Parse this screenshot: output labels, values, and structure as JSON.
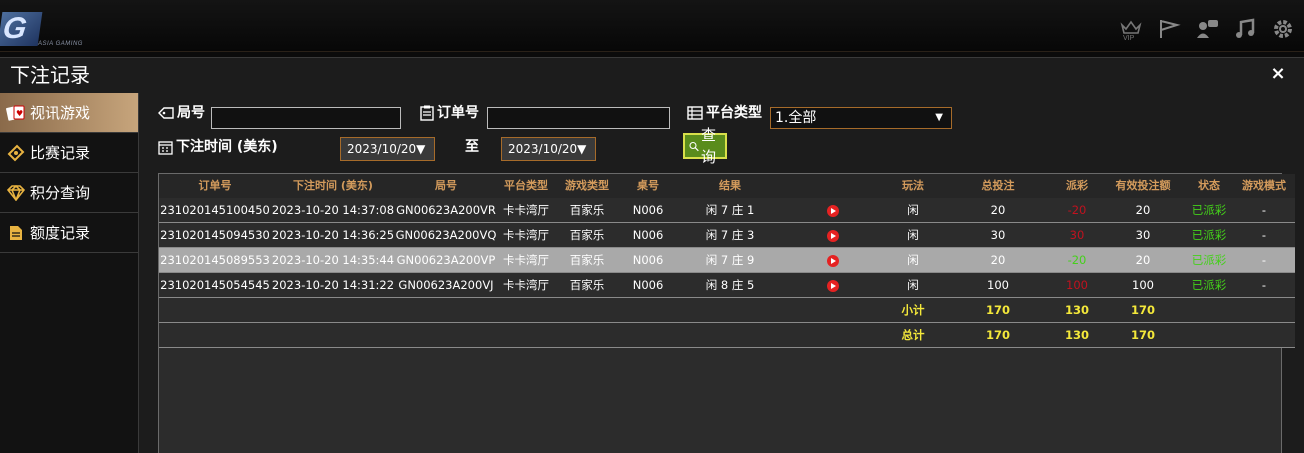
{
  "app": {
    "logo_letter": "G",
    "logo_text": "ASIA GAMING",
    "top_icons": [
      "vip-icon",
      "flag-icon",
      "chat-icon",
      "music-icon",
      "gear-icon"
    ]
  },
  "dialog": {
    "title": "下注记录",
    "close_label": "×"
  },
  "sidebar": {
    "items": [
      {
        "label": "视讯游戏",
        "icon": "cards-icon",
        "active": true
      },
      {
        "label": "比赛记录",
        "icon": "ticket-icon",
        "active": false
      },
      {
        "label": "积分查询",
        "icon": "diamond-icon",
        "active": false
      },
      {
        "label": "额度记录",
        "icon": "document-icon",
        "active": false
      }
    ]
  },
  "filters": {
    "round_label": "局号",
    "round_value": "",
    "order_label": "订单号",
    "order_value": "",
    "platform_label": "平台类型",
    "platform_value": "1.全部",
    "time_label": "下注时间 (美东)",
    "date_from": "2023/10/20▼",
    "to_label": "至",
    "date_to": "2023/10/20▼",
    "query_label": "查询"
  },
  "table": {
    "headers": [
      "订单号",
      "下注时间 (美东)",
      "局号",
      "平台类型",
      "游戏类型",
      "桌号",
      "结果",
      "",
      "玩法",
      "总投注",
      "派彩",
      "有效投注额",
      "状态",
      "游戏模式"
    ],
    "rows": [
      {
        "order": "231020145100450",
        "time": "2023-10-20 14:37:08",
        "round": "GN00623A200VR",
        "platform": "卡卡湾厅",
        "game": "百家乐",
        "table": "N006",
        "result": "闲 7 庄 1",
        "bet": "闲",
        "total": "20",
        "payout": "-20",
        "payout_color": "red",
        "valid": "20",
        "status": "已派彩",
        "mode": "-"
      },
      {
        "order": "231020145094530",
        "time": "2023-10-20 14:36:25",
        "round": "GN00623A200VQ",
        "platform": "卡卡湾厅",
        "game": "百家乐",
        "table": "N006",
        "result": "闲 7 庄 3",
        "bet": "闲",
        "total": "30",
        "payout": "30",
        "payout_color": "red",
        "valid": "30",
        "status": "已派彩",
        "mode": "-"
      },
      {
        "order": "231020145089553",
        "time": "2023-10-20 14:35:44",
        "round": "GN00623A200VP",
        "platform": "卡卡湾厅",
        "game": "百家乐",
        "table": "N006",
        "result": "闲 7 庄 9",
        "bet": "闲",
        "total": "20",
        "payout": "-20",
        "payout_color": "green",
        "valid": "20",
        "status": "已派彩",
        "mode": "-"
      },
      {
        "order": "231020145054545",
        "time": "2023-10-20 14:31:22",
        "round": "GN00623A200VJ",
        "platform": "卡卡湾厅",
        "game": "百家乐",
        "table": "N006",
        "result": "闲 8 庄 5",
        "bet": "闲",
        "total": "100",
        "payout": "100",
        "payout_color": "red",
        "valid": "100",
        "status": "已派彩",
        "mode": "-"
      }
    ],
    "subtotal": {
      "label": "小计",
      "total": "170",
      "payout": "130",
      "valid": "170"
    },
    "grandtotal": {
      "label": "总计",
      "total": "170",
      "payout": "130",
      "valid": "170"
    },
    "selected_row": 2
  },
  "colors": {
    "header_text": "#d39b5c",
    "status_green": "#44d11a",
    "payout_red": "#c1121f",
    "sum_yellow": "#f4e83a",
    "active_tab": "#c7a57c"
  }
}
